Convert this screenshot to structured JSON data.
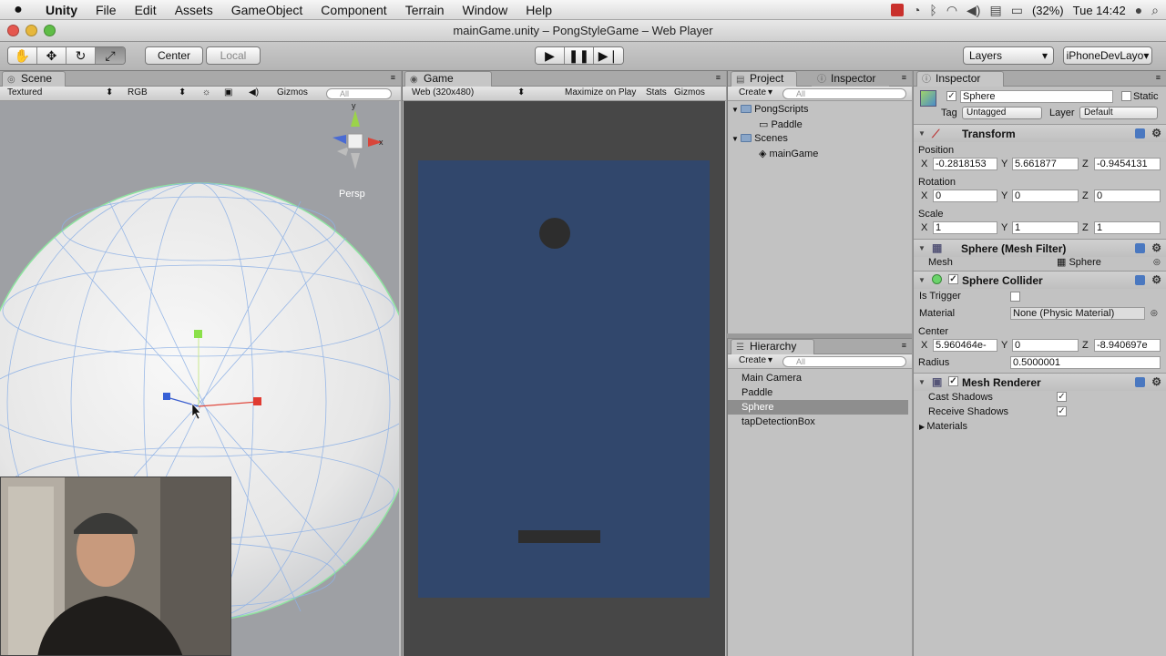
{
  "menubar": {
    "app": "Unity",
    "items": [
      "File",
      "Edit",
      "Assets",
      "GameObject",
      "Component",
      "Terrain",
      "Window",
      "Help"
    ],
    "battery": "(32%)",
    "clock": "Tue 14:42"
  },
  "window": {
    "title": "mainGame.unity – PongStyleGame – Web Player"
  },
  "toolbar": {
    "pivot": "Center",
    "space": "Local",
    "layers": "Layers",
    "layout": "iPhoneDevLayo▾"
  },
  "scene": {
    "tab": "Scene",
    "render_mode": "Textured",
    "color_mode": "RGB",
    "gizmos": "Gizmos",
    "search_placeholder": "All",
    "view_label": "Persp"
  },
  "game": {
    "tab": "Game",
    "aspect": "Web (320x480)",
    "maximize": "Maximize on Play",
    "stats": "Stats",
    "gizmos": "Gizmos"
  },
  "project": {
    "tab": "Project",
    "tab2": "Inspector",
    "create": "Create",
    "search_placeholder": "All",
    "folder1": "PongScripts",
    "item1": "Paddle",
    "folder2": "Scenes",
    "item2": "mainGame"
  },
  "hierarchy": {
    "tab": "Hierarchy",
    "create": "Create",
    "search_placeholder": "All",
    "items": [
      "Main Camera",
      "Paddle",
      "Sphere",
      "tapDetectionBox"
    ]
  },
  "inspector": {
    "tab": "Inspector",
    "object_name": "Sphere",
    "static_label": "Static",
    "tag_label": "Tag",
    "tag_value": "Untagged",
    "layer_label": "Layer",
    "layer_value": "Default",
    "transform": {
      "title": "Transform",
      "position_label": "Position",
      "rotation_label": "Rotation",
      "scale_label": "Scale",
      "pos": [
        "-0.2818153",
        "5.661877",
        "-0.9454131"
      ],
      "rot": [
        "0",
        "0",
        "0"
      ],
      "scale": [
        "1",
        "1",
        "1"
      ],
      "x": "X",
      "y": "Y",
      "z": "Z"
    },
    "mesh_filter": {
      "title": "Sphere (Mesh Filter)",
      "mesh_label": "Mesh",
      "mesh_value": "Sphere"
    },
    "collider": {
      "title": "Sphere Collider",
      "trigger_label": "Is Trigger",
      "material_label": "Material",
      "material_value": "None (Physic Material)",
      "center_label": "Center",
      "center": [
        "5.960464e-",
        "0",
        "-8.940697e"
      ],
      "radius_label": "Radius",
      "radius_value": "0.5000001"
    },
    "renderer": {
      "title": "Mesh Renderer",
      "cast_label": "Cast Shadows",
      "receive_label": "Receive Shadows",
      "materials_label": "Materials"
    }
  }
}
